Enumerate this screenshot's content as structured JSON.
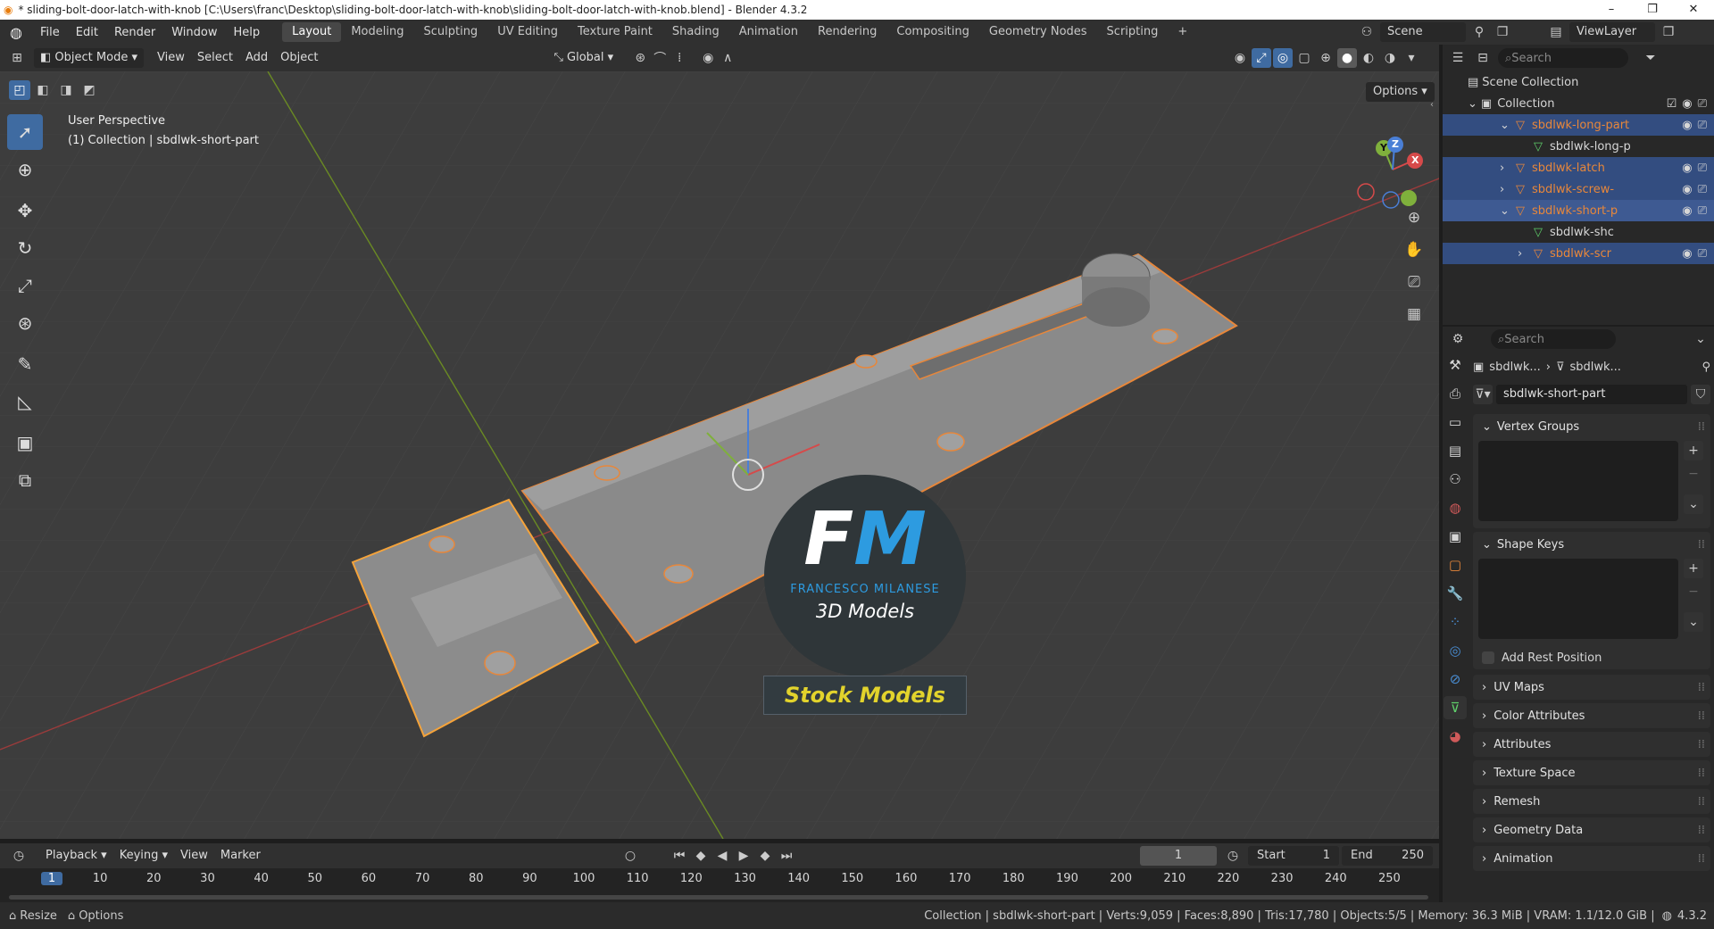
{
  "window": {
    "title": "* sliding-bolt-door-latch-with-knob [C:\\Users\\franc\\Desktop\\sliding-bolt-door-latch-with-knob\\sliding-bolt-door-latch-with-knob.blend] - Blender 4.3.2",
    "controls": [
      "–",
      "❐",
      "✕"
    ]
  },
  "menu": [
    "File",
    "Edit",
    "Render",
    "Window",
    "Help"
  ],
  "workspaces": [
    "Layout",
    "Modeling",
    "Sculpting",
    "UV Editing",
    "Texture Paint",
    "Shading",
    "Animation",
    "Rendering",
    "Compositing",
    "Geometry Nodes",
    "Scripting"
  ],
  "active_workspace": "Layout",
  "add_tab": "+",
  "scene": "Scene",
  "view_layer": "ViewLayer",
  "viewport_header": {
    "mode": "Object Mode",
    "menus": [
      "View",
      "Select",
      "Add",
      "Object"
    ],
    "orientation": "Global",
    "options": "Options"
  },
  "viewport": {
    "perspective": "User Perspective",
    "collection_info": "(1) Collection | sbdlwk-short-part",
    "logo_initials_f": "F",
    "logo_initials_m": "M",
    "logo_name": "FRANCESCO MILANESE",
    "logo_sub": "3D Models",
    "banner": "Stock Models",
    "gizmo": {
      "x": "X",
      "y": "Y",
      "z": "Z"
    }
  },
  "outliner": {
    "search_placeholder": "Search",
    "root": "Scene Collection",
    "collection": "Collection",
    "items": [
      {
        "label": "sbdlwk-long-part",
        "indent": 1,
        "kind": "object",
        "selected": true
      },
      {
        "label": "sbdlwk-long-p",
        "indent": 2,
        "kind": "mesh",
        "selected": false
      },
      {
        "label": "sbdlwk-latch",
        "indent": 1,
        "kind": "object",
        "selected": true
      },
      {
        "label": "sbdlwk-screw-",
        "indent": 1,
        "kind": "object",
        "selected": true
      },
      {
        "label": "sbdlwk-short-p",
        "indent": 1,
        "kind": "object",
        "selected": true,
        "active": true
      },
      {
        "label": "sbdlwk-shc",
        "indent": 2,
        "kind": "mesh",
        "selected": false
      },
      {
        "label": "sbdlwk-scr",
        "indent": 2,
        "kind": "object",
        "selected": true
      }
    ]
  },
  "properties": {
    "search_placeholder": "Search",
    "breadcrumb_obj": "sbdlwk...",
    "breadcrumb_mesh": "sbdlwk...",
    "mesh_name": "sbdlwk-short-part",
    "panels": {
      "vertex_groups": "Vertex Groups",
      "shape_keys": "Shape Keys",
      "add_rest_position": "Add Rest Position",
      "collapsed": [
        "UV Maps",
        "Color Attributes",
        "Attributes",
        "Texture Space",
        "Remesh",
        "Geometry Data",
        "Animation"
      ]
    }
  },
  "timeline": {
    "menus": [
      "Playback",
      "Keying",
      "View",
      "Marker"
    ],
    "current_frame": "1",
    "start_label": "Start",
    "start": "1",
    "end_label": "End",
    "end": "250",
    "ticks": [
      "1",
      "10",
      "20",
      "30",
      "40",
      "50",
      "60",
      "70",
      "80",
      "90",
      "100",
      "110",
      "120",
      "130",
      "140",
      "150",
      "160",
      "170",
      "180",
      "190",
      "200",
      "210",
      "220",
      "230",
      "240",
      "250"
    ]
  },
  "statusbar": {
    "left1": "Resize",
    "left2": "Options",
    "info": "Collection | sbdlwk-short-part | Verts:9,059 | Faces:8,890 | Tris:17,780 | Objects:5/5 | Memory: 36.3 MiB | VRAM: 1.1/12.0 GiB |",
    "version": "4.3.2"
  },
  "colors": {
    "accent": "#3f6ba1",
    "selection": "#e8873a",
    "header": "#303030"
  }
}
